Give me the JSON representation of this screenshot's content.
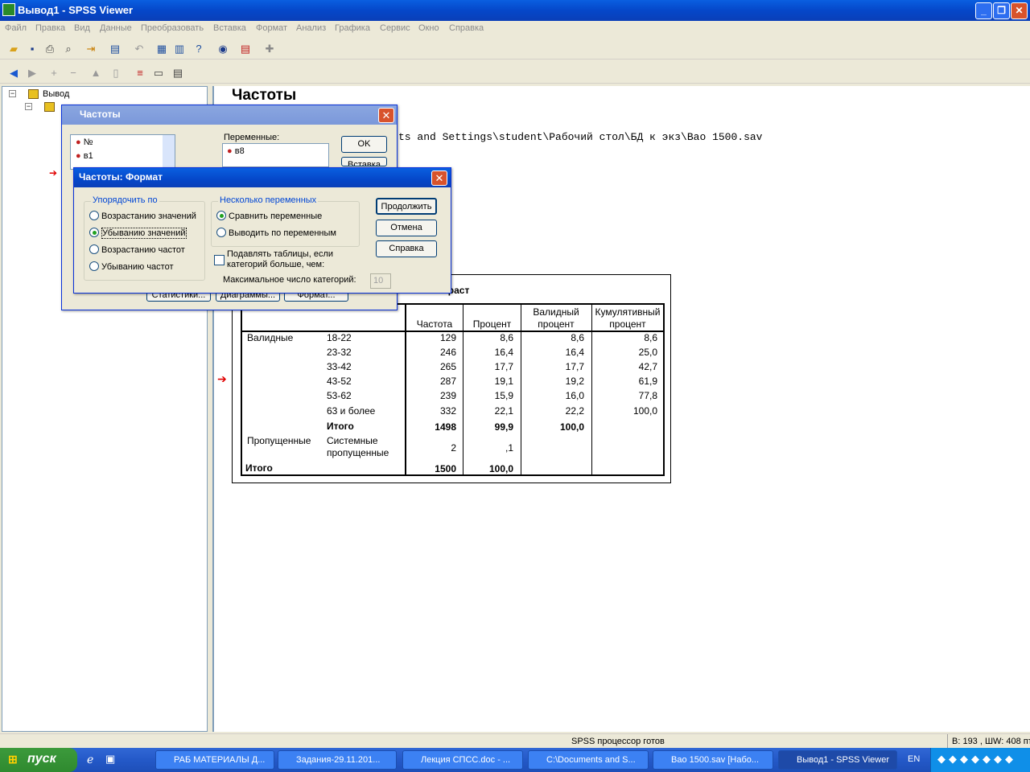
{
  "window": {
    "title": "Вывод1 - SPSS Viewer"
  },
  "menu": [
    "Файл",
    "Правка",
    "Вид",
    "Данные",
    "Преобразовать",
    "Вставка",
    "Формат",
    "Анализ",
    "Графика",
    "Сервис",
    "Окно",
    "Справка"
  ],
  "tree": {
    "root": "Вывод"
  },
  "output": {
    "heading": "Частоты",
    "path_text": "ts and Settings\\student\\Рабочий стол\\БД к экз\\Вао 1500.sav",
    "table_title": "Возраст"
  },
  "freq_table": {
    "headers": {
      "freq": "Частота",
      "pct": "Процент",
      "valid": "Валидный процент",
      "cum": "Кумулятивный процент"
    },
    "valid_label": "Валидные",
    "rows": [
      {
        "cat": "18-22",
        "freq": "129",
        "pct": "8,6",
        "valid": "8,6",
        "cum": "8,6"
      },
      {
        "cat": "23-32",
        "freq": "246",
        "pct": "16,4",
        "valid": "16,4",
        "cum": "25,0"
      },
      {
        "cat": "33-42",
        "freq": "265",
        "pct": "17,7",
        "valid": "17,7",
        "cum": "42,7"
      },
      {
        "cat": "43-52",
        "freq": "287",
        "pct": "19,1",
        "valid": "19,2",
        "cum": "61,9"
      },
      {
        "cat": "53-62",
        "freq": "239",
        "pct": "15,9",
        "valid": "16,0",
        "cum": "77,8"
      },
      {
        "cat": "63 и более",
        "freq": "332",
        "pct": "22,1",
        "valid": "22,2",
        "cum": "100,0"
      }
    ],
    "subtotal": {
      "label": "Итого",
      "freq": "1498",
      "pct": "99,9",
      "valid": "100,0"
    },
    "missing": {
      "label": "Пропущенные",
      "cat": "Системные пропущенные",
      "freq": "2",
      "pct": ",1"
    },
    "total": {
      "label": "Итого",
      "freq": "1500",
      "pct": "100,0"
    }
  },
  "dlg_freq": {
    "title": "Частоты",
    "vars": [
      "№",
      "в1"
    ],
    "sel_label": "Переменные:",
    "sel_vars": [
      "в8"
    ],
    "ok": "OK",
    "paste": "Вставка",
    "stats": "Статистики...",
    "charts": "Диаграммы...",
    "format": "Формат..."
  },
  "dlg_format": {
    "title": "Частоты: Формат",
    "order_label": "Упорядочить по",
    "order_opts": [
      "Возрастанию значений",
      "Убыванию значений",
      "Возрастанию частот",
      "Убыванию частот"
    ],
    "order_selected": 1,
    "multi_label": "Несколько переменных",
    "multi_opts": [
      "Сравнить переменные",
      "Выводить по переменным"
    ],
    "multi_selected": 0,
    "suppress_label": "Подавлять таблицы, если категорий больше, чем:",
    "max_label": "Максимальное число категорий:",
    "max_value": "10",
    "continue": "Продолжить",
    "cancel": "Отмена",
    "help": "Справка"
  },
  "status": {
    "text": "SPSS процессор готов",
    "pos": "В: 193 , ШW: 408 пт"
  },
  "taskbar": {
    "start": "пуск",
    "tasks": [
      "РАБ МАТЕРИАЛЫ Д...",
      "Задания-29.11.201...",
      "Лекция СПСС.doc - ...",
      "C:\\Documents and S...",
      "Вао 1500.sav [Набо...",
      "Вывод1 - SPSS Viewer"
    ],
    "lang": "EN"
  }
}
